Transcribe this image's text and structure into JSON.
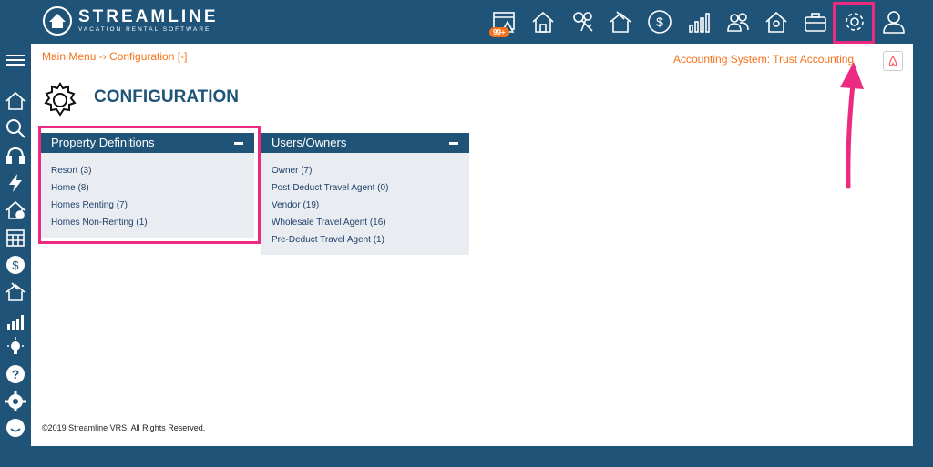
{
  "brand": {
    "name": "STREAMLINE",
    "tagline": "VACATION RENTAL SOFTWARE"
  },
  "topnav": {
    "badge": "99+",
    "icons": [
      "alerts-icon",
      "home-icon",
      "keys-icon",
      "house-sweep-icon",
      "dollar-icon",
      "bar-chart-icon",
      "users-icon",
      "owner-house-icon",
      "toolbox-icon",
      "gear-icon",
      "user-icon"
    ]
  },
  "breadcrumb": "Main Menu -› Configuration [-]",
  "accounting": "Accounting System: Trust Accounting",
  "page_title": "CONFIGURATION",
  "panels": [
    {
      "title": "Property Definitions",
      "items": [
        "Resort (3)",
        "Home (8)",
        "Homes Renting (7)",
        "Homes Non-Renting (1)"
      ]
    },
    {
      "title": "Users/Owners",
      "items": [
        "Owner (7)",
        "Post-Deduct Travel Agent (0)",
        "Vendor (19)",
        "Wholesale Travel Agent (16)",
        "Pre-Deduct Travel Agent (1)"
      ]
    }
  ],
  "footer": "©2019 Streamline VRS. All Rights Reserved.",
  "colors": {
    "brand": "#1f5478",
    "accent": "#f7731c",
    "highlight": "#ec2a7f"
  }
}
